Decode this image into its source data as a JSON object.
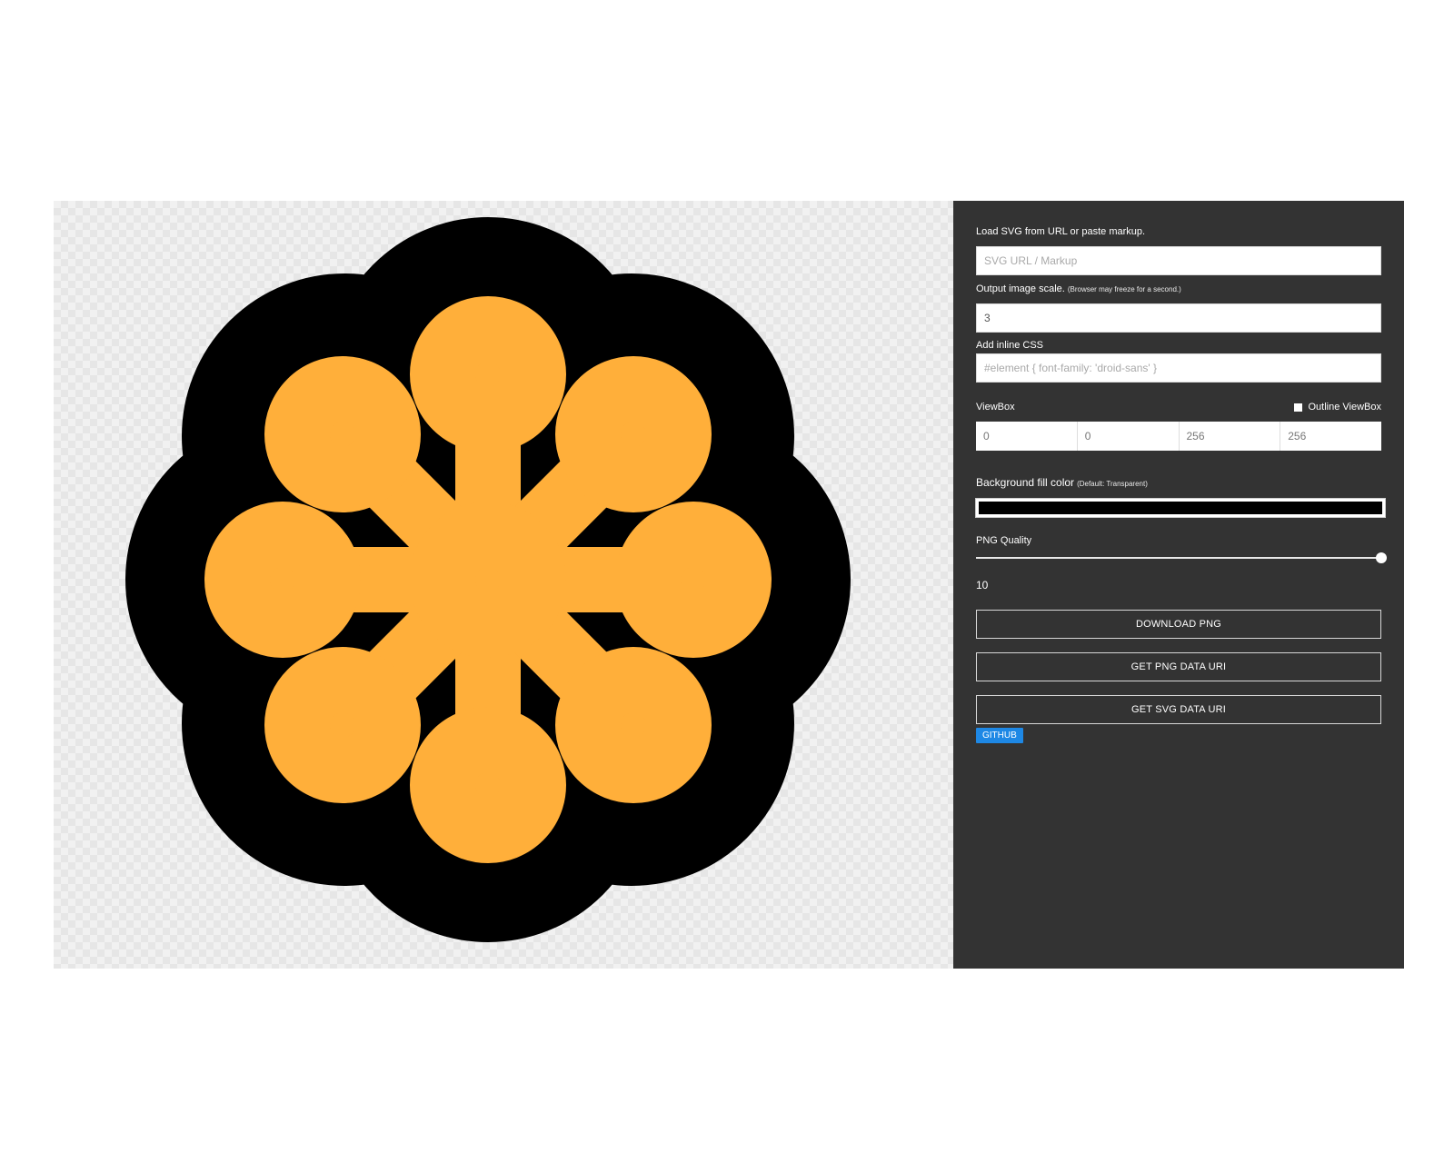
{
  "load": {
    "label": "Load SVG from URL or paste markup.",
    "placeholder": "SVG URL / Markup"
  },
  "scale": {
    "label": "Output image scale.",
    "note": "(Browser may freeze for a second.)",
    "value": "3"
  },
  "css": {
    "label": "Add inline CSS",
    "placeholder": "#element { font-family: 'droid-sans' }"
  },
  "viewbox": {
    "label": "ViewBox",
    "outline_label": "Outline ViewBox",
    "outline_checked": false,
    "values": [
      "0",
      "0",
      "256",
      "256"
    ]
  },
  "background": {
    "label": "Background fill color",
    "note": "(Default: Transparent)",
    "color": "#000000"
  },
  "quality": {
    "label": "PNG Quality",
    "value": "10",
    "level": 1.0
  },
  "buttons": {
    "download_png": "DOWNLOAD PNG",
    "png_data_uri": "GET PNG DATA URI",
    "svg_data_uri": "GET SVG DATA URI",
    "github": "GITHUB"
  },
  "preview": {
    "icon": "asterisk-flower-icon",
    "fill_color": "#FFAF3A",
    "outline_color": "#000000"
  }
}
